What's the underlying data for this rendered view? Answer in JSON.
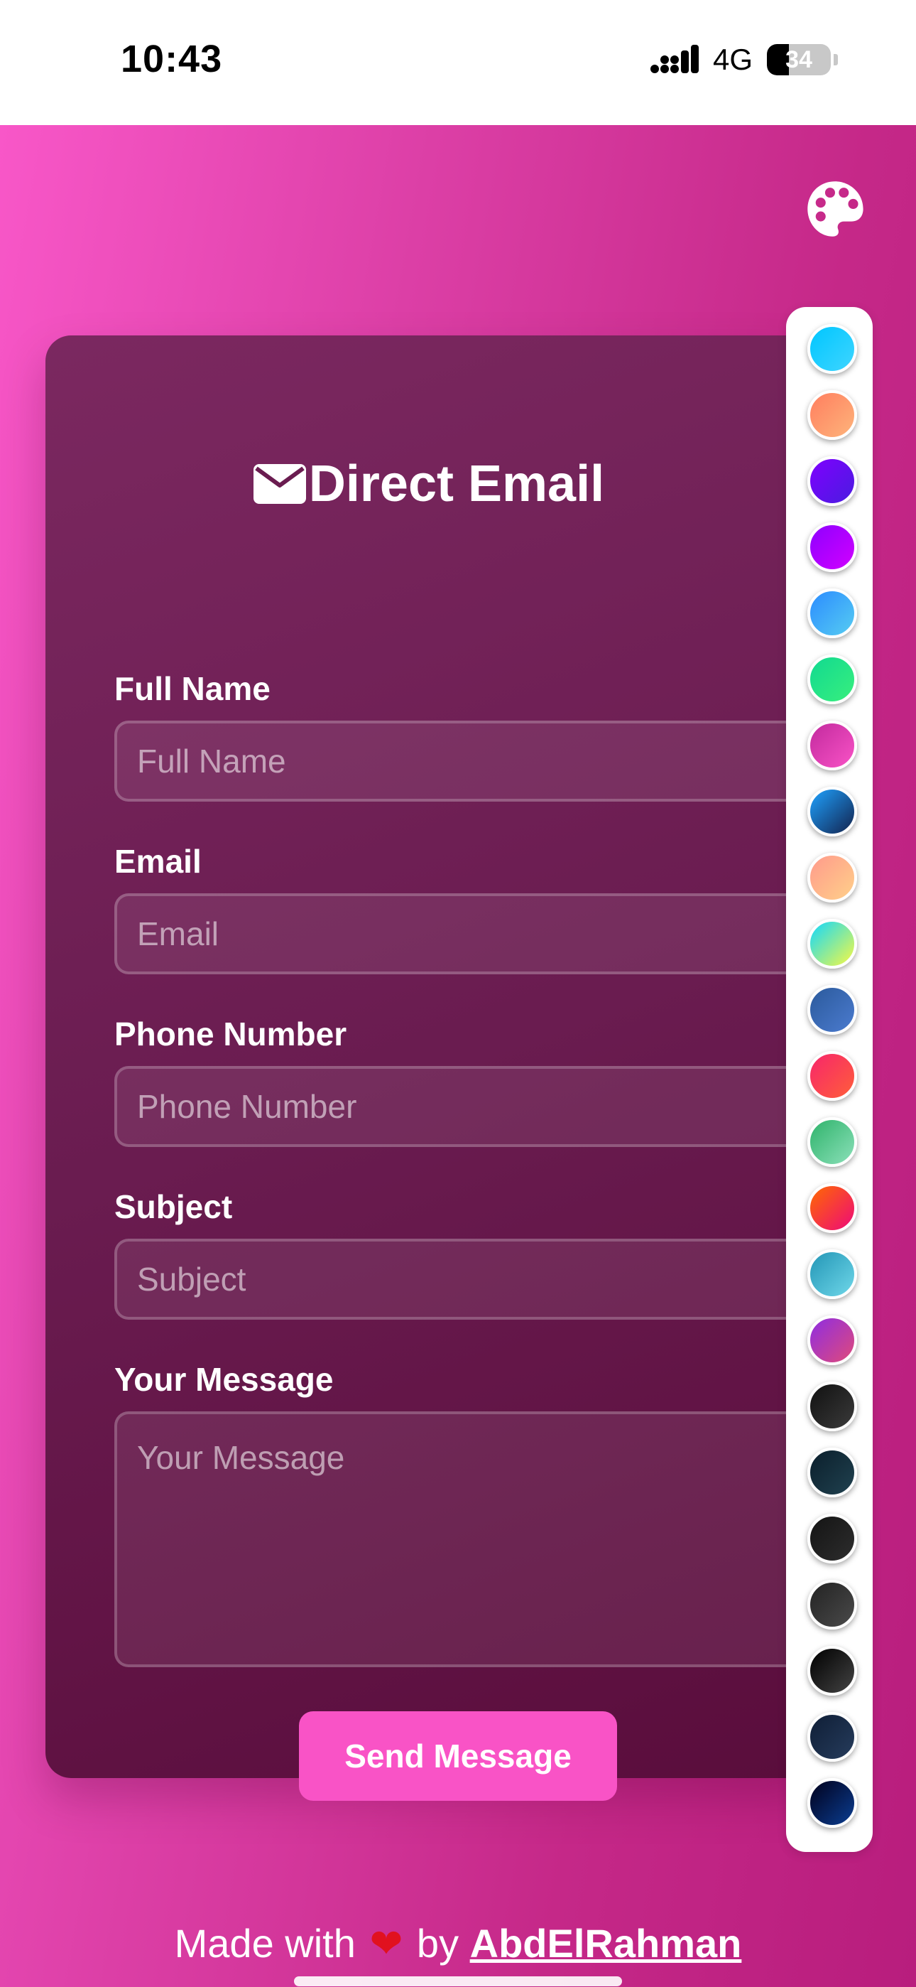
{
  "status_bar": {
    "time": "10:43",
    "network": "4G",
    "battery_level": "34",
    "battery_fraction": 0.34
  },
  "app": {
    "theme_toggle_icon": "palette-icon",
    "form": {
      "title": "Direct Email",
      "title_icon": "envelope-icon",
      "fields": [
        {
          "label": "Full Name",
          "placeholder": "Full Name"
        },
        {
          "label": "Email",
          "placeholder": "Email"
        },
        {
          "label": "Phone Number",
          "placeholder": "Phone Number"
        },
        {
          "label": "Subject",
          "placeholder": "Subject"
        },
        {
          "label": "Your Message",
          "placeholder": "Your Message"
        }
      ],
      "submit_label": "Send Message"
    },
    "swatches": [
      {
        "colors": [
          "#00c6ff",
          "#3fd5ff"
        ]
      },
      {
        "colors": [
          "#ff7e5f",
          "#feb47b"
        ]
      },
      {
        "colors": [
          "#7f00ff",
          "#4a1ce0"
        ]
      },
      {
        "colors": [
          "#8e00ff",
          "#d100ff"
        ]
      },
      {
        "colors": [
          "#2b8cff",
          "#56ccf2"
        ]
      },
      {
        "colors": [
          "#11d991",
          "#38ef7d"
        ]
      },
      {
        "colors": [
          "#c22a9e",
          "#f953c6"
        ]
      },
      {
        "colors": [
          "#1fa2ff",
          "#12224d"
        ]
      },
      {
        "colors": [
          "#ff9a8b",
          "#ffd08a"
        ]
      },
      {
        "colors": [
          "#0fd8ff",
          "#f9f941"
        ]
      },
      {
        "colors": [
          "#2b5a9c",
          "#4b7bcf"
        ]
      },
      {
        "colors": [
          "#f7266b",
          "#ff5e3a"
        ]
      },
      {
        "colors": [
          "#2fb36b",
          "#8be0b9"
        ]
      },
      {
        "colors": [
          "#ff6a00",
          "#ee0979"
        ]
      },
      {
        "colors": [
          "#2396b6",
          "#6fd7e9"
        ]
      },
      {
        "colors": [
          "#8e2de2",
          "#e04a7a"
        ]
      },
      {
        "colors": [
          "#111111",
          "#3a3a3a"
        ]
      },
      {
        "colors": [
          "#0b1f2c",
          "#20414f"
        ]
      },
      {
        "colors": [
          "#141414",
          "#2d2d2d"
        ]
      },
      {
        "colors": [
          "#232323",
          "#4a4a4a"
        ]
      },
      {
        "colors": [
          "#000000",
          "#434343"
        ]
      },
      {
        "colors": [
          "#0f1e36",
          "#263c5c"
        ]
      },
      {
        "colors": [
          "#01011c",
          "#0b3d91"
        ]
      }
    ],
    "footer": {
      "prefix": "Made with",
      "heart": "❤",
      "by": "by",
      "author": "AbdElRahman"
    }
  }
}
